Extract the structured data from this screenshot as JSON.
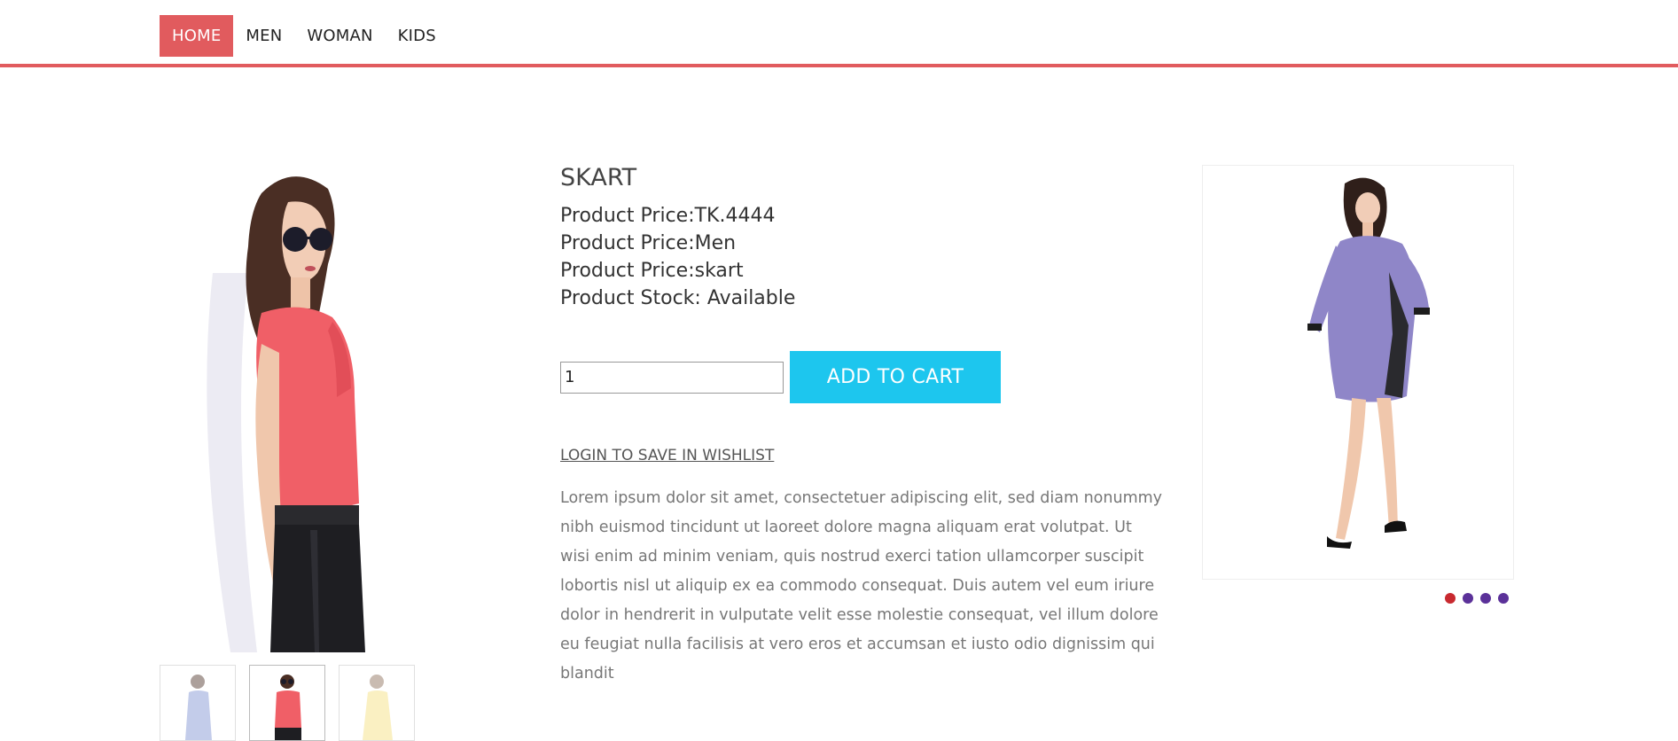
{
  "nav": {
    "items": [
      {
        "label": "HOME",
        "active": true
      },
      {
        "label": "MEN",
        "active": false
      },
      {
        "label": "WOMAN",
        "active": false
      },
      {
        "label": "KIDS",
        "active": false
      }
    ],
    "accent_color": "#e15b5e"
  },
  "gallery": {
    "main_image": "woman-in-coral-top-and-black-skirt",
    "thumbnails": [
      {
        "image": "woman-in-blue-dress",
        "selected": false
      },
      {
        "image": "woman-in-coral-top-and-black-skirt",
        "selected": true
      },
      {
        "image": "woman-in-yellow-dress",
        "selected": false
      }
    ]
  },
  "product": {
    "title": "SKART",
    "price_line": "Product Price:TK.4444",
    "category_line": "Product Price:Men",
    "name_line": "Product Price:skart",
    "stock_line": "Product Stock: Available"
  },
  "cart": {
    "quantity_value": "1",
    "add_label": "ADD TO CART",
    "button_color": "#1dc6ee"
  },
  "wishlist": {
    "label": "LOGIN TO SAVE IN WISHLIST"
  },
  "description": "Lorem ipsum dolor sit amet, consectetuer adipiscing elit, sed diam nonummy nibh euismod tincidunt ut laoreet dolore magna aliquam erat volutpat. Ut wisi enim ad minim veniam, quis nostrud exerci tation ullamcorper suscipit lobortis nisl ut aliquip ex ea commodo consequat. Duis autem vel eum iriure dolor in hendrerit in vulputate velit esse molestie consequat, vel illum dolore eu feugiat nulla facilisis at vero eros et accumsan et iusto odio dignissim qui blandit",
  "slider": {
    "image": "woman-in-purple-printed-dress",
    "dots": [
      {
        "active": true
      },
      {
        "active": false
      },
      {
        "active": false
      },
      {
        "active": false
      }
    ],
    "active_dot_color": "#c8292f",
    "dot_color": "#5b3199"
  }
}
